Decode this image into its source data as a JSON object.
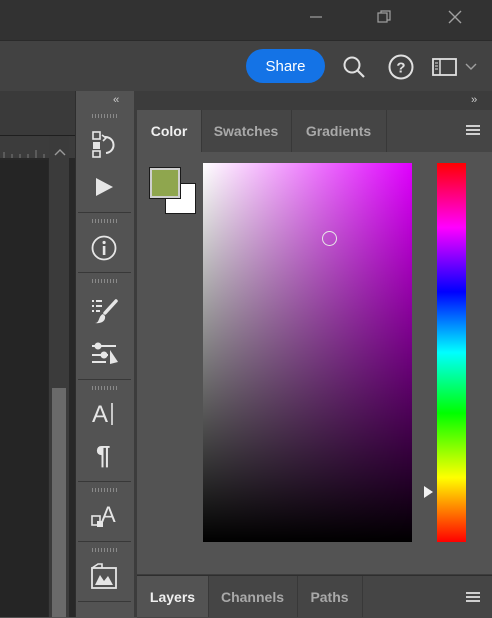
{
  "header": {
    "share_label": "Share"
  },
  "panel": {
    "collapse_left": "‹‹",
    "collapse_right": "››",
    "top_tabs": [
      {
        "label": "Color",
        "active": true
      },
      {
        "label": "Swatches",
        "active": false
      },
      {
        "label": "Gradients",
        "active": false
      }
    ],
    "bottom_tabs": [
      {
        "label": "Layers",
        "active": true
      },
      {
        "label": "Channels",
        "active": false
      },
      {
        "label": "Paths",
        "active": false
      }
    ]
  },
  "color": {
    "foreground": "#8fa64e",
    "background": "#ffffff",
    "hue_top": "#ff0000",
    "field_hue": "#e000ff"
  },
  "tools": [
    {
      "icon": "history-icon"
    },
    {
      "icon": "play-actions-icon"
    },
    {
      "icon": "info-icon"
    },
    {
      "icon": "brush-settings-icon"
    },
    {
      "icon": "adjustments-icon"
    },
    {
      "icon": "character-icon"
    },
    {
      "icon": "paragraph-icon"
    },
    {
      "icon": "glyphs-icon"
    },
    {
      "icon": "libraries-icon"
    }
  ]
}
